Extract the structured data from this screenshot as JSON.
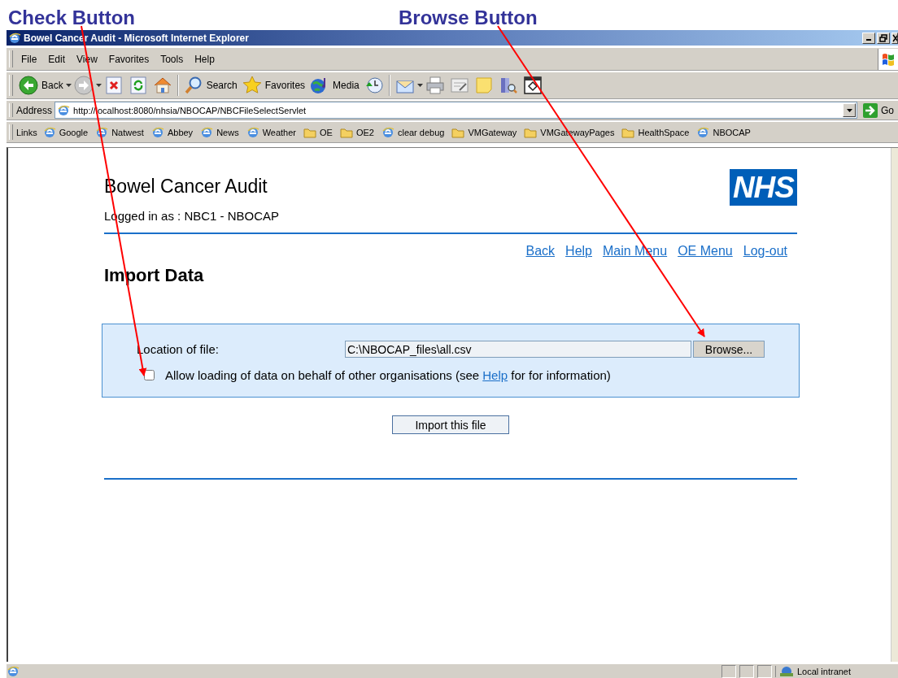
{
  "annotations": [
    {
      "label": "Check Button"
    },
    {
      "label": "Browse Button"
    }
  ],
  "window": {
    "title": "Bowel Cancer Audit - Microsoft Internet Explorer"
  },
  "menu": [
    "File",
    "Edit",
    "View",
    "Favorites",
    "Tools",
    "Help"
  ],
  "toolbar": [
    {
      "kind": "back",
      "label": "Back"
    },
    {
      "kind": "forward"
    },
    {
      "kind": "stop"
    },
    {
      "kind": "refresh"
    },
    {
      "kind": "home"
    },
    {
      "kind": "search",
      "label": "Search"
    },
    {
      "kind": "favorites",
      "label": "Favorites"
    },
    {
      "kind": "media",
      "label": "Media"
    },
    {
      "kind": "history"
    },
    {
      "kind": "mail"
    },
    {
      "kind": "print"
    },
    {
      "kind": "edit"
    },
    {
      "kind": "note"
    },
    {
      "kind": "research"
    },
    {
      "kind": "frame"
    }
  ],
  "address": {
    "label": "Address",
    "url": "http://localhost:8080/nhsia/NBOCAP/NBCFileSelectServlet",
    "go": "Go"
  },
  "links": {
    "label": "Links",
    "items": [
      {
        "kind": "page",
        "label": "Google"
      },
      {
        "kind": "page",
        "label": "Natwest"
      },
      {
        "kind": "page",
        "label": "Abbey"
      },
      {
        "kind": "page",
        "label": "News"
      },
      {
        "kind": "page",
        "label": "Weather"
      },
      {
        "kind": "folder",
        "label": "OE"
      },
      {
        "kind": "folder",
        "label": "OE2"
      },
      {
        "kind": "page",
        "label": "clear debug"
      },
      {
        "kind": "folder",
        "label": "VMGateway"
      },
      {
        "kind": "folder",
        "label": "VMGatewayPages"
      },
      {
        "kind": "folder",
        "label": "HealthSpace"
      },
      {
        "kind": "page",
        "label": "NBOCAP"
      }
    ]
  },
  "page": {
    "title": "Bowel Cancer Audit",
    "logged_in": "Logged in as : NBC1 - NBOCAP",
    "logo": "NHS",
    "nav": [
      "Back",
      "Help",
      "Main Menu",
      "OE Menu",
      "Log-out"
    ],
    "heading": "Import Data",
    "form": {
      "file_label": "Location of file:",
      "file_value": "C:\\NBOCAP_files\\all.csv",
      "browse": "Browse...",
      "allow_checked": false,
      "allow_before": "Allow loading of data on behalf of other organisations (see ",
      "allow_link": "Help",
      "allow_after": " for for information)"
    },
    "submit": "Import this file"
  },
  "status_bar": {
    "zone": "Local intranet"
  }
}
